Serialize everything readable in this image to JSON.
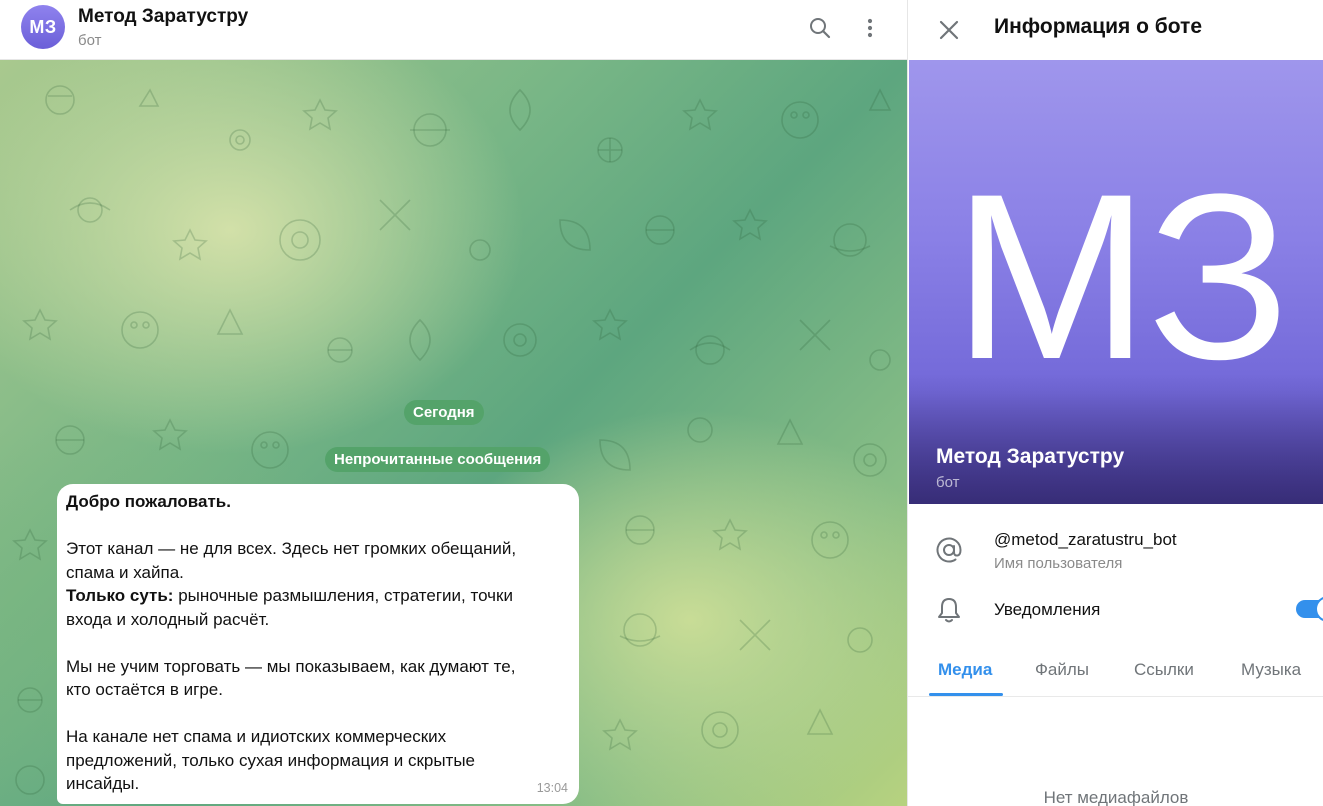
{
  "chat": {
    "avatar_initials": "МЗ",
    "title": "Метод Заратустру",
    "subtitle": "бот",
    "date_pill": "Сегодня",
    "unread_pill": "Непрочитанные сообщения",
    "message": {
      "heading": "Добро пожаловать.",
      "line1": "Этот канал — не для всех. Здесь нет громких обещаний,",
      "line2": "спама и хайпа.",
      "bold_prefix": "Только суть:",
      "line3_rest": " рыночные размышления, стратегии, точки",
      "line4": "входа и холодный расчёт.",
      "line5": "Мы не учим торговать — мы показываем, как думают те,",
      "line6": "кто остаётся в игре.",
      "line7": "На канале нет спама и идиотских коммерческих",
      "line8": "предложений, только сухая информация и скрытые",
      "line9": "инсайды.",
      "time": "13:04"
    }
  },
  "side": {
    "title": "Информация о боте",
    "cover_initials": "МЗ",
    "cover_name": "Метод Заратустру",
    "cover_sub": "бот",
    "username": "@metod_zaratustru_bot",
    "username_label": "Имя пользователя",
    "notifications_label": "Уведомления",
    "notifications_on": true,
    "tabs": [
      "Медиа",
      "Файлы",
      "Ссылки",
      "Музыка"
    ],
    "active_tab": "Медиа",
    "empty_text": "Нет медиафайлов"
  },
  "colors": {
    "accent": "#3390ec",
    "avatar": "#7a6ee0",
    "pill": "#54a36a"
  }
}
